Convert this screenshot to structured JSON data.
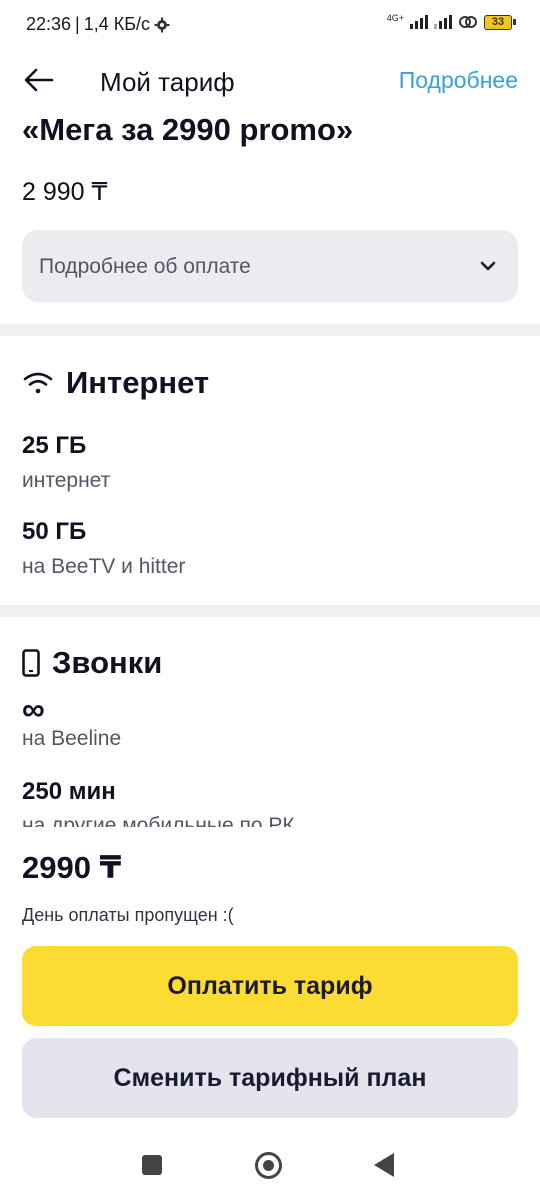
{
  "status_bar": {
    "time": "22:36",
    "separator": "|",
    "speed": "1,4 КБ/с",
    "network_type": "4G+",
    "battery": "33"
  },
  "header": {
    "title": "Мой тариф",
    "details_link": "Подробнее"
  },
  "tariff": {
    "name": "«Мега за 2990 promo»",
    "price": "2 990 ₸",
    "payment_details_label": "Подробнее об оплате"
  },
  "internet": {
    "title": "Интернет",
    "items": [
      {
        "value": "25 ГБ",
        "desc": "интернет"
      },
      {
        "value": "50 ГБ",
        "desc": "на BeeTV и hitter"
      }
    ]
  },
  "calls": {
    "title": "Звонки",
    "items": [
      {
        "value": "∞",
        "desc": "на Beeline"
      },
      {
        "value": "250 мин",
        "desc": "на другие мобильные по РК"
      }
    ]
  },
  "footer": {
    "total_price": "2990 ₸",
    "missed_note": "День оплаты пропущен :(",
    "pay_button": "Оплатить тариф",
    "change_button": "Сменить тарифный план"
  },
  "colors": {
    "accent_link": "#3aa0d8",
    "pay_button": "#fcdb32",
    "secondary_button": "#e4e4ec"
  }
}
